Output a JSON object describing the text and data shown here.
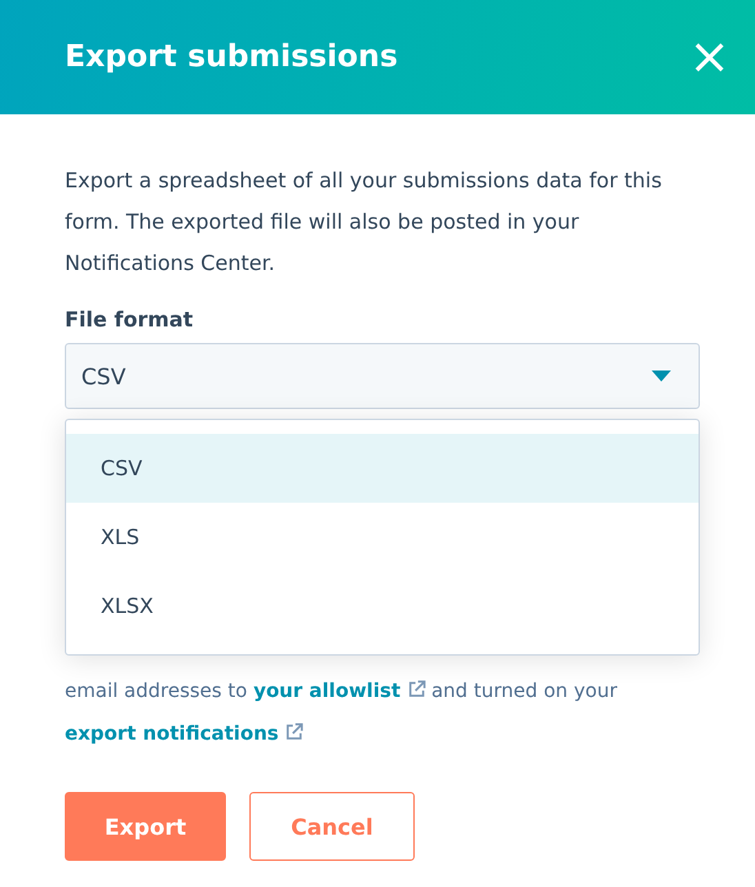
{
  "dialog": {
    "title": "Export submissions",
    "close_label": "×"
  },
  "description": "Export a spreadsheet of all your submissions data for this form. The exported file will also be posted in your Notifications Center.",
  "file_format": {
    "label": "File format",
    "value": "CSV",
    "expanded": true,
    "options": [
      {
        "label": "CSV",
        "selected": true
      },
      {
        "label": "XLS",
        "selected": false
      },
      {
        "label": "XLSX",
        "selected": false
      }
    ]
  },
  "note": {
    "text_before": "email addresses to",
    "link_1": "your allowlist",
    "text_middle": "and turned on your",
    "link_2": "export notifications"
  },
  "buttons": [
    {
      "label": "Export",
      "kind": "primary"
    },
    {
      "label": "Cancel",
      "kind": "secondary"
    }
  ]
}
